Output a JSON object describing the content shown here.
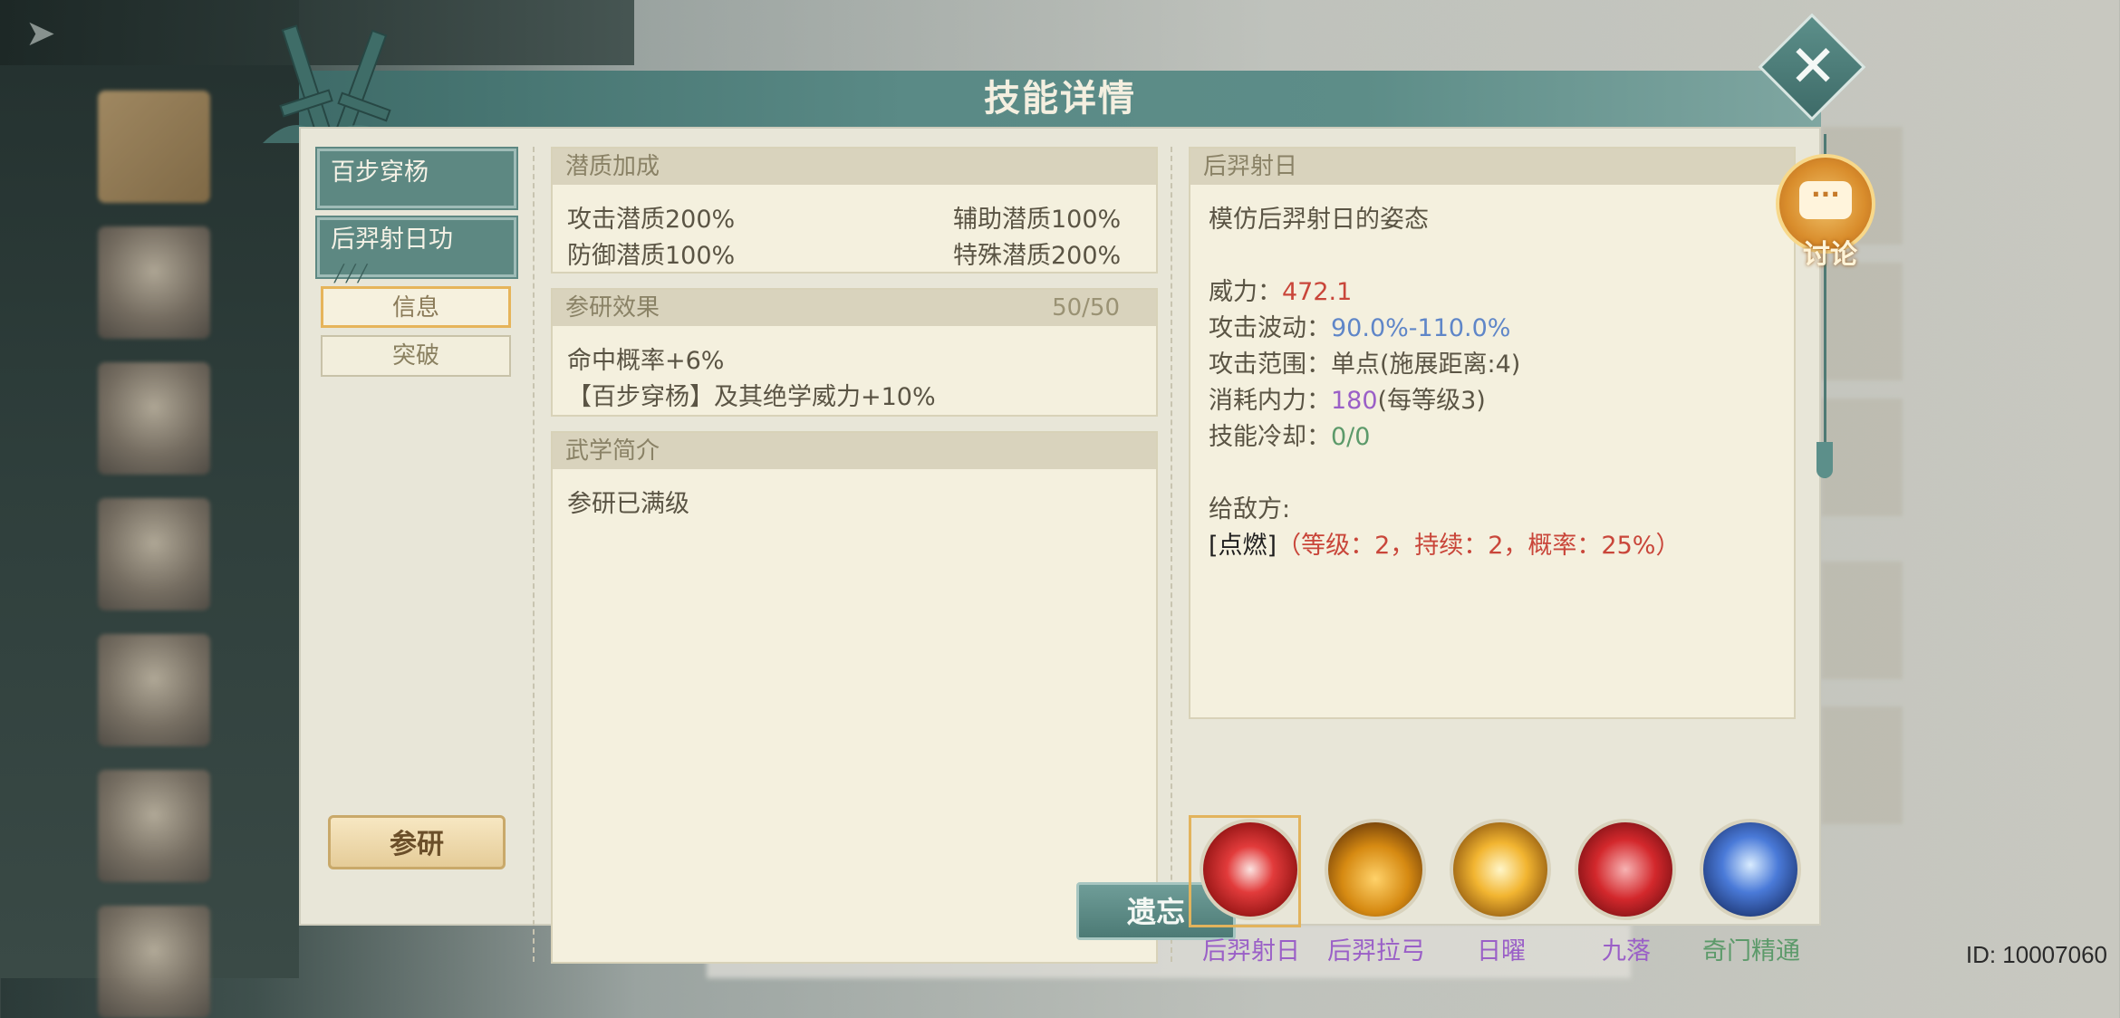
{
  "dialog": {
    "title": "技能详情"
  },
  "tabs": {
    "skill_1": "百步穿杨",
    "skill_2": "后羿射日功",
    "info": "信息",
    "breakthrough": "突破",
    "research_button": "参研"
  },
  "potential": {
    "header": "潜质加成",
    "attack": "攻击潜质200%",
    "support": "辅助潜质100%",
    "defense": "防御潜质100%",
    "special": "特殊潜质200%"
  },
  "research": {
    "header": "参研效果",
    "progress": "50/50",
    "line1": "命中概率+6%",
    "line2": "【百步穿杨】及其绝学威力+10%"
  },
  "intro": {
    "header": "武学简介",
    "text": "参研已满级",
    "forget_button": "遗忘"
  },
  "detail": {
    "header": "后羿射日",
    "description": "模仿后羿射日的姿态",
    "power_label": "威力：",
    "power_value": "472.1",
    "fluctuation_label": "攻击波动：",
    "fluctuation_value": "90.0%-110.0%",
    "range_label": "攻击范围：",
    "range_value": "单点(施展距离:4)",
    "cost_label": "消耗内力：",
    "cost_value": "180",
    "cost_suffix": "(每等级3)",
    "cooldown_label": "技能冷却：",
    "cooldown_value": "0/0",
    "enemy_label": "给敌方:",
    "effect_name": "[点燃]",
    "effect_detail": "（等级：2，持续：2，概率：25%）"
  },
  "skills": [
    {
      "name": "后羿射日",
      "color": "#9a5fc7"
    },
    {
      "name": "后羿拉弓",
      "color": "#9a5fc7"
    },
    {
      "name": "日曜",
      "color": "#9a5fc7"
    },
    {
      "name": "九落",
      "color": "#9a5fc7"
    },
    {
      "name": "奇门精通",
      "color": "#5c9a6a"
    }
  ],
  "discuss": {
    "label": "讨论"
  },
  "footer": {
    "id": "ID: 10007060"
  },
  "icons": [
    "back-arrow-icon",
    "close-icon",
    "chat-bubble-icon",
    "crossed-swords-icon"
  ]
}
